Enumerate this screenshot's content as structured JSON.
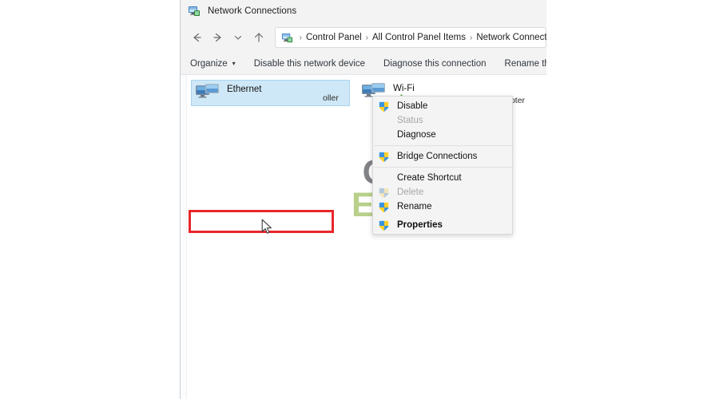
{
  "window": {
    "title": "Network Connections",
    "title_icon": "network-connections-icon"
  },
  "nav": {
    "back_icon": "arrow-left-icon",
    "forward_icon": "arrow-right-icon",
    "recent_icon": "chevron-down-icon",
    "up_icon": "arrow-up-icon",
    "address_icon": "network-connections-icon",
    "breadcrumbs": [
      {
        "label": "Control Panel"
      },
      {
        "label": "All Control Panel Items"
      },
      {
        "label": "Network Connections"
      }
    ],
    "separator": "›"
  },
  "command_bar": {
    "items": [
      {
        "label": "Organize",
        "has_caret": true
      },
      {
        "label": "Disable this network device",
        "has_caret": false
      },
      {
        "label": "Diagnose this connection",
        "has_caret": false
      },
      {
        "label": "Rename this conne",
        "has_caret": false
      }
    ],
    "caret": "▾"
  },
  "connections": [
    {
      "name": "Ethernet",
      "subtitle": "",
      "trailing_visible": "oller",
      "selected": true,
      "icon": "network-adapter-icon"
    },
    {
      "name": "Wi-Fi",
      "subtitle": "TP-LINK Wireless USB Adapter",
      "selected": false,
      "icon": "network-adapter-icon",
      "signal_icon": "wireless-signal-icon"
    }
  ],
  "context_menu": {
    "items": [
      {
        "label": "Disable",
        "shield": true,
        "disabled": false,
        "bold": false,
        "separator_after": false
      },
      {
        "label": "Status",
        "shield": false,
        "disabled": true,
        "bold": false,
        "separator_after": false
      },
      {
        "label": "Diagnose",
        "shield": false,
        "disabled": false,
        "bold": false,
        "separator_after": true
      },
      {
        "label": "Bridge Connections",
        "shield": true,
        "disabled": false,
        "bold": false,
        "separator_after": true
      },
      {
        "label": "Create Shortcut",
        "shield": false,
        "disabled": false,
        "bold": false,
        "separator_after": false
      },
      {
        "label": "Delete",
        "shield": true,
        "disabled": true,
        "bold": false,
        "separator_after": false
      },
      {
        "label": "Rename",
        "shield": true,
        "disabled": false,
        "bold": false,
        "separator_after": false
      },
      {
        "label": "Properties",
        "shield": true,
        "disabled": false,
        "bold": true,
        "separator_after": false
      }
    ],
    "highlighted_item": "Properties"
  },
  "annotation": {
    "highlight_color": "#e8262b",
    "highlight_target": "Properties",
    "cursor_icon": "mouse-pointer-icon"
  },
  "watermark": {
    "line1": "GAMES",
    "line2": "ERRORS",
    "color1": "#808285",
    "color2": "#b8d08a"
  }
}
